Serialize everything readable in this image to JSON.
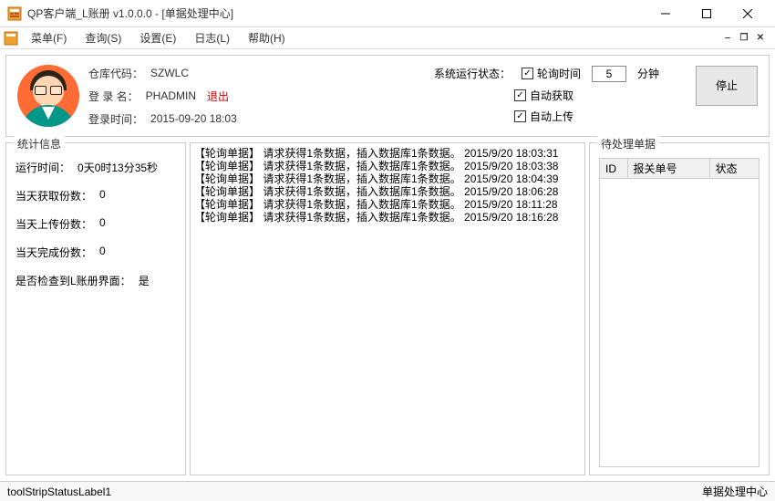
{
  "titlebar": {
    "title": "QP客户端_L账册 v1.0.0.0 - [单据处理中心]"
  },
  "menubar": {
    "items": [
      {
        "label": "菜单(F)"
      },
      {
        "label": "查询(S)"
      },
      {
        "label": "设置(E)"
      },
      {
        "label": "日志(L)"
      },
      {
        "label": "帮助(H)"
      }
    ]
  },
  "header": {
    "warehouse_label": "仓库代码：",
    "warehouse_value": "SZWLC",
    "login_name_label": "登 录 名：",
    "login_name_value": "PHADMIN",
    "logout_label": "退出",
    "login_time_label": "登录时间：",
    "login_time_value": "2015-09-20 18:03",
    "status_label": "系统运行状态：",
    "poll_label": "轮询时间",
    "poll_value": "5",
    "poll_unit": "分钟",
    "auto_fetch_label": "自动获取",
    "auto_upload_label": "自动上传",
    "stop_label": "停止"
  },
  "stats": {
    "legend": "统计信息",
    "runtime_label": "运行时间：",
    "runtime_value": "0天0时13分35秒",
    "fetch_count_label": "当天获取份数：",
    "fetch_count_value": "0",
    "upload_count_label": "当天上传份数：",
    "upload_count_value": "0",
    "complete_count_label": "当天完成份数：",
    "complete_count_value": "0",
    "check_label": "是否检查到L账册界面：",
    "check_value": "是"
  },
  "log": {
    "lines": [
      "【轮询单据】 请求获得1条数据，插入数据库1条数据。 2015/9/20 18:03:31",
      "【轮询单据】 请求获得1条数据，插入数据库1条数据。 2015/9/20 18:03:38",
      "【轮询单据】 请求获得1条数据，插入数据库1条数据。 2015/9/20 18:04:39",
      "【轮询单据】 请求获得1条数据，插入数据库1条数据。 2015/9/20 18:06:28",
      "【轮询单据】 请求获得1条数据，插入数据库1条数据。 2015/9/20 18:11:28",
      "【轮询单据】 请求获得1条数据，插入数据库1条数据。 2015/9/20 18:16:28"
    ]
  },
  "pending": {
    "legend": "待处理单据",
    "columns": [
      "ID",
      "报关单号",
      "状态"
    ]
  },
  "statusbar": {
    "left": "toolStripStatusLabel1",
    "right": "单据处理中心"
  }
}
